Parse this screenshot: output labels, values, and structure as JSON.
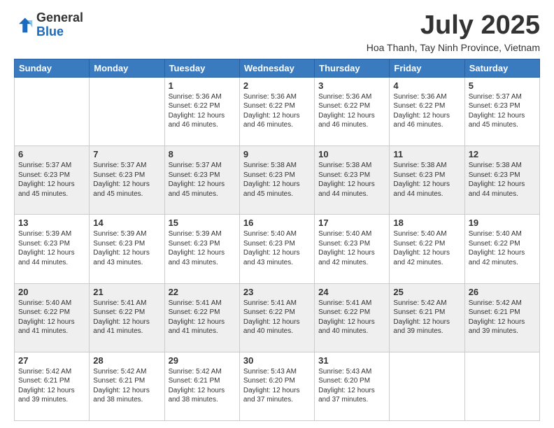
{
  "logo": {
    "general": "General",
    "blue": "Blue"
  },
  "title": "July 2025",
  "location": "Hoa Thanh, Tay Ninh Province, Vietnam",
  "days_of_week": [
    "Sunday",
    "Monday",
    "Tuesday",
    "Wednesday",
    "Thursday",
    "Friday",
    "Saturday"
  ],
  "weeks": [
    [
      {
        "day": "",
        "info": ""
      },
      {
        "day": "",
        "info": ""
      },
      {
        "day": "1",
        "info": "Sunrise: 5:36 AM\nSunset: 6:22 PM\nDaylight: 12 hours and 46 minutes."
      },
      {
        "day": "2",
        "info": "Sunrise: 5:36 AM\nSunset: 6:22 PM\nDaylight: 12 hours and 46 minutes."
      },
      {
        "day": "3",
        "info": "Sunrise: 5:36 AM\nSunset: 6:22 PM\nDaylight: 12 hours and 46 minutes."
      },
      {
        "day": "4",
        "info": "Sunrise: 5:36 AM\nSunset: 6:22 PM\nDaylight: 12 hours and 46 minutes."
      },
      {
        "day": "5",
        "info": "Sunrise: 5:37 AM\nSunset: 6:23 PM\nDaylight: 12 hours and 45 minutes."
      }
    ],
    [
      {
        "day": "6",
        "info": "Sunrise: 5:37 AM\nSunset: 6:23 PM\nDaylight: 12 hours and 45 minutes."
      },
      {
        "day": "7",
        "info": "Sunrise: 5:37 AM\nSunset: 6:23 PM\nDaylight: 12 hours and 45 minutes."
      },
      {
        "day": "8",
        "info": "Sunrise: 5:37 AM\nSunset: 6:23 PM\nDaylight: 12 hours and 45 minutes."
      },
      {
        "day": "9",
        "info": "Sunrise: 5:38 AM\nSunset: 6:23 PM\nDaylight: 12 hours and 45 minutes."
      },
      {
        "day": "10",
        "info": "Sunrise: 5:38 AM\nSunset: 6:23 PM\nDaylight: 12 hours and 44 minutes."
      },
      {
        "day": "11",
        "info": "Sunrise: 5:38 AM\nSunset: 6:23 PM\nDaylight: 12 hours and 44 minutes."
      },
      {
        "day": "12",
        "info": "Sunrise: 5:38 AM\nSunset: 6:23 PM\nDaylight: 12 hours and 44 minutes."
      }
    ],
    [
      {
        "day": "13",
        "info": "Sunrise: 5:39 AM\nSunset: 6:23 PM\nDaylight: 12 hours and 44 minutes."
      },
      {
        "day": "14",
        "info": "Sunrise: 5:39 AM\nSunset: 6:23 PM\nDaylight: 12 hours and 43 minutes."
      },
      {
        "day": "15",
        "info": "Sunrise: 5:39 AM\nSunset: 6:23 PM\nDaylight: 12 hours and 43 minutes."
      },
      {
        "day": "16",
        "info": "Sunrise: 5:40 AM\nSunset: 6:23 PM\nDaylight: 12 hours and 43 minutes."
      },
      {
        "day": "17",
        "info": "Sunrise: 5:40 AM\nSunset: 6:23 PM\nDaylight: 12 hours and 42 minutes."
      },
      {
        "day": "18",
        "info": "Sunrise: 5:40 AM\nSunset: 6:22 PM\nDaylight: 12 hours and 42 minutes."
      },
      {
        "day": "19",
        "info": "Sunrise: 5:40 AM\nSunset: 6:22 PM\nDaylight: 12 hours and 42 minutes."
      }
    ],
    [
      {
        "day": "20",
        "info": "Sunrise: 5:40 AM\nSunset: 6:22 PM\nDaylight: 12 hours and 41 minutes."
      },
      {
        "day": "21",
        "info": "Sunrise: 5:41 AM\nSunset: 6:22 PM\nDaylight: 12 hours and 41 minutes."
      },
      {
        "day": "22",
        "info": "Sunrise: 5:41 AM\nSunset: 6:22 PM\nDaylight: 12 hours and 41 minutes."
      },
      {
        "day": "23",
        "info": "Sunrise: 5:41 AM\nSunset: 6:22 PM\nDaylight: 12 hours and 40 minutes."
      },
      {
        "day": "24",
        "info": "Sunrise: 5:41 AM\nSunset: 6:22 PM\nDaylight: 12 hours and 40 minutes."
      },
      {
        "day": "25",
        "info": "Sunrise: 5:42 AM\nSunset: 6:21 PM\nDaylight: 12 hours and 39 minutes."
      },
      {
        "day": "26",
        "info": "Sunrise: 5:42 AM\nSunset: 6:21 PM\nDaylight: 12 hours and 39 minutes."
      }
    ],
    [
      {
        "day": "27",
        "info": "Sunrise: 5:42 AM\nSunset: 6:21 PM\nDaylight: 12 hours and 39 minutes."
      },
      {
        "day": "28",
        "info": "Sunrise: 5:42 AM\nSunset: 6:21 PM\nDaylight: 12 hours and 38 minutes."
      },
      {
        "day": "29",
        "info": "Sunrise: 5:42 AM\nSunset: 6:21 PM\nDaylight: 12 hours and 38 minutes."
      },
      {
        "day": "30",
        "info": "Sunrise: 5:43 AM\nSunset: 6:20 PM\nDaylight: 12 hours and 37 minutes."
      },
      {
        "day": "31",
        "info": "Sunrise: 5:43 AM\nSunset: 6:20 PM\nDaylight: 12 hours and 37 minutes."
      },
      {
        "day": "",
        "info": ""
      },
      {
        "day": "",
        "info": ""
      }
    ]
  ]
}
